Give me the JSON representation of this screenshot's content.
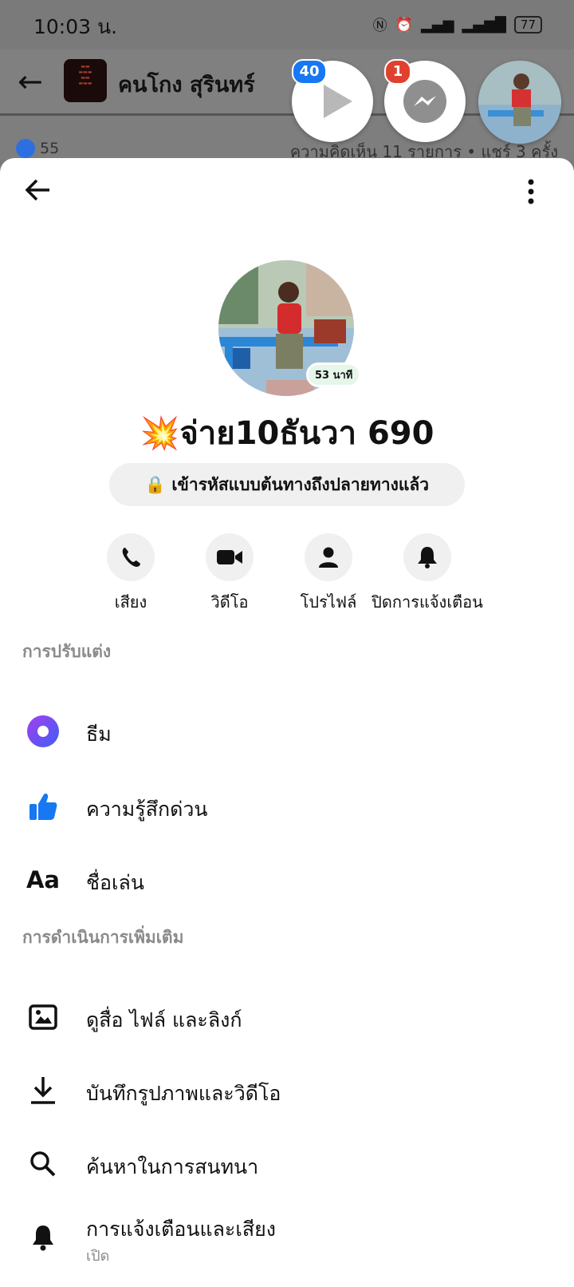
{
  "status_bar": {
    "time": "10:03 น.",
    "battery": "77"
  },
  "background": {
    "page_name": "คนโกง สุรินทร์",
    "likes": "55",
    "comments_shares": "ความคิดเห็น 11 รายการ • แชร์ 3 ครั้ง"
  },
  "chat_heads": {
    "video_badge": "40",
    "messenger_badge": "1"
  },
  "profile": {
    "name": "💥จ่าย10ธันวา 690",
    "active_badge": "53 นาที",
    "encryption": "เข้ารหัสแบบต้นทางถึงปลายทางแล้ว"
  },
  "actions": [
    {
      "label": "เสียง",
      "icon": "phone-icon"
    },
    {
      "label": "วิดีโอ",
      "icon": "video-camera-icon"
    },
    {
      "label": "โปรไฟล์",
      "icon": "person-icon"
    },
    {
      "label": "ปิดการแจ้งเตือน",
      "icon": "bell-icon"
    }
  ],
  "customization": {
    "heading": "การปรับแต่ง",
    "items": [
      {
        "label": "ธีม",
        "icon": "theme-icon"
      },
      {
        "label": "ความรู้สึกด่วน",
        "icon": "thumbs-up-icon"
      },
      {
        "label": "ชื่อเล่น",
        "icon": "nickname-icon",
        "glyph": "Aa"
      }
    ]
  },
  "more_actions": {
    "heading": "การดำเนินการเพิ่มเติม",
    "items": [
      {
        "label": "ดูสื่อ ไฟล์ และลิงก์",
        "icon": "image-icon"
      },
      {
        "label": "บันทึกรูปภาพและวิดีโอ",
        "icon": "download-icon"
      },
      {
        "label": "ค้นหาในการสนทนา",
        "icon": "search-icon"
      },
      {
        "label": "การแจ้งเตือนและเสียง",
        "icon": "bell-icon",
        "sub": "เปิด"
      }
    ]
  },
  "colors": {
    "accent": "#1877f2",
    "badge_red": "#e0412f",
    "theme_purple": "#7b3ff2"
  }
}
